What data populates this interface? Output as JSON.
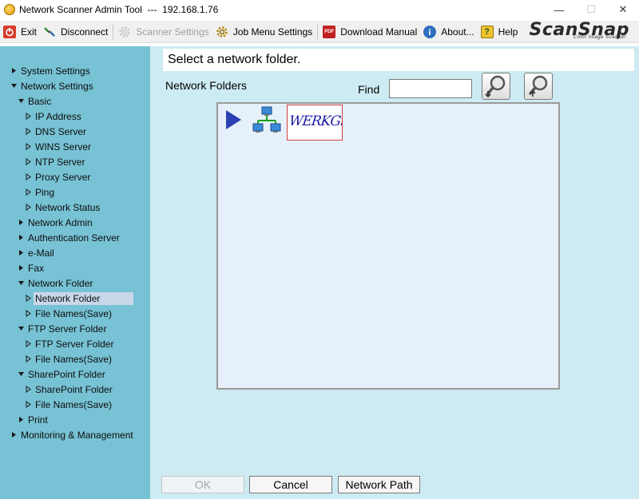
{
  "window": {
    "title": "Network Scanner Admin Tool  ---  192.168.1.76",
    "minimize": "—",
    "maximize": "☐",
    "close": "✕"
  },
  "toolbar": {
    "exit": "Exit",
    "disconnect": "Disconnect",
    "scanner_settings": "Scanner Settings",
    "job_menu_settings": "Job Menu Settings",
    "download_manual": "Download Manual",
    "about": "About...",
    "help": "Help",
    "pdf_badge": "PDF"
  },
  "logo": {
    "brand": "ScanSnap",
    "tagline": "Color Image Scanner"
  },
  "sidebar": {
    "items": [
      {
        "label": "System Settings",
        "level": 0,
        "state": "collapsed"
      },
      {
        "label": "Network Settings",
        "level": 0,
        "state": "expanded"
      },
      {
        "label": "Basic",
        "level": 1,
        "state": "expanded"
      },
      {
        "label": "IP Address",
        "level": 2,
        "state": "leaf"
      },
      {
        "label": "DNS Server",
        "level": 2,
        "state": "leaf"
      },
      {
        "label": "WINS Server",
        "level": 2,
        "state": "leaf"
      },
      {
        "label": "NTP Server",
        "level": 2,
        "state": "leaf"
      },
      {
        "label": "Proxy Server",
        "level": 2,
        "state": "leaf"
      },
      {
        "label": "Ping",
        "level": 2,
        "state": "leaf"
      },
      {
        "label": "Network Status",
        "level": 2,
        "state": "leaf"
      },
      {
        "label": "Network Admin",
        "level": 1,
        "state": "collapsed"
      },
      {
        "label": "Authentication Server",
        "level": 1,
        "state": "collapsed"
      },
      {
        "label": "e-Mail",
        "level": 1,
        "state": "collapsed"
      },
      {
        "label": "Fax",
        "level": 1,
        "state": "collapsed"
      },
      {
        "label": "Network Folder",
        "level": 1,
        "state": "expanded"
      },
      {
        "label": "Network Folder",
        "level": 2,
        "state": "leaf",
        "selected": true
      },
      {
        "label": "File Names(Save)",
        "level": 2,
        "state": "leaf"
      },
      {
        "label": "FTP Server Folder",
        "level": 1,
        "state": "expanded"
      },
      {
        "label": "FTP Server Folder",
        "level": 2,
        "state": "leaf"
      },
      {
        "label": "File Names(Save)",
        "level": 2,
        "state": "leaf"
      },
      {
        "label": "SharePoint Folder",
        "level": 1,
        "state": "expanded"
      },
      {
        "label": "SharePoint Folder",
        "level": 2,
        "state": "leaf"
      },
      {
        "label": "File Names(Save)",
        "level": 2,
        "state": "leaf"
      },
      {
        "label": "Print",
        "level": 1,
        "state": "collapsed"
      },
      {
        "label": "Monitoring & Management",
        "level": 0,
        "state": "collapsed"
      }
    ]
  },
  "main": {
    "header": "Select a network folder.",
    "section_label": "Network Folders",
    "find_label": "Find",
    "find_value": "",
    "folder_name_thumbnail": "WERKGr",
    "buttons": {
      "ok": "OK",
      "cancel": "Cancel",
      "network_path": "Network Path"
    }
  },
  "colors": {
    "sidebar_bg": "#77c2d4",
    "main_bg": "#cdebf2",
    "selected_bg": "#c9d7ea",
    "arrow_blue": "#2a3fb3"
  }
}
